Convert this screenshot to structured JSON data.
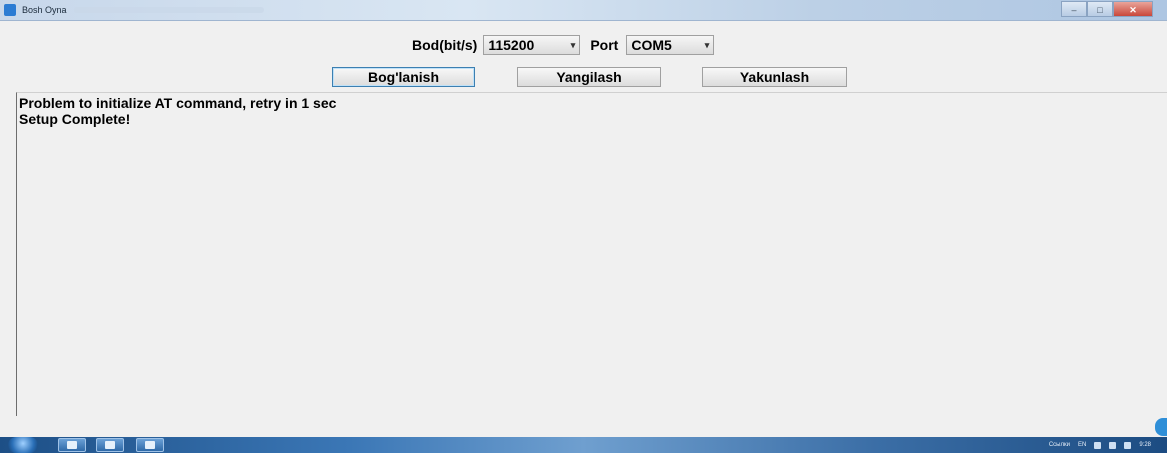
{
  "window": {
    "title": "Bosh Oyna",
    "controls": {
      "minimize": "–",
      "maximize": "□",
      "close": "✕"
    }
  },
  "settings": {
    "baud_label": "Bod(bit/s)",
    "baud_value": "115200",
    "port_label": "Port",
    "port_value": "COM5"
  },
  "buttons": {
    "connect": "Bog'lanish",
    "refresh": "Yangilash",
    "finish": "Yakunlash"
  },
  "log": {
    "lines": [
      "Problem to initialize AT command, retry in 1 sec",
      "Setup Complete!"
    ]
  },
  "taskbar": {
    "tray_links": "Ссылки",
    "language": "EN",
    "clock": "9:28"
  },
  "icons": {
    "app": "app-icon",
    "dropdown": "chevron-down-icon",
    "start": "windows-start-icon"
  }
}
